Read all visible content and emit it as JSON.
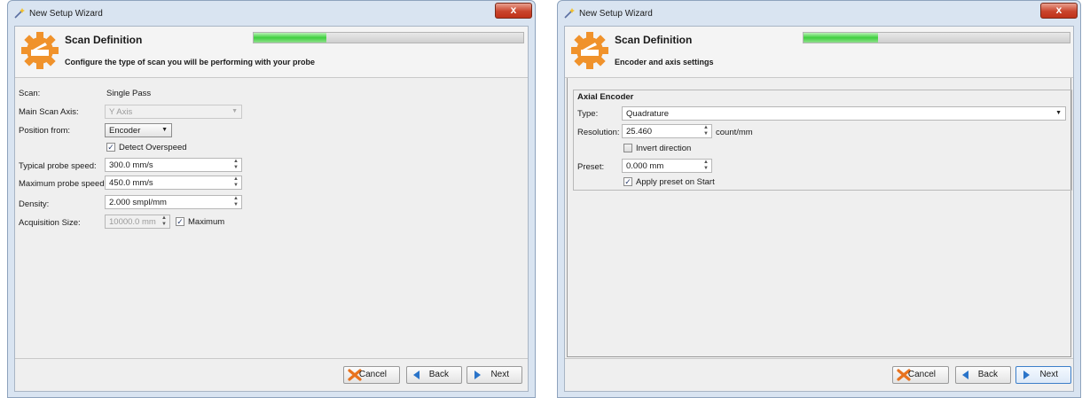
{
  "left_window": {
    "title": "New Setup Wizard",
    "close_label": "x",
    "header": {
      "title": "Scan Definition",
      "subtitle": "Configure the type of scan you will be performing with your probe",
      "progress_fraction": 0.27
    },
    "form": {
      "scan_label": "Scan:",
      "scan_value": "Single Pass",
      "main_axis_label": "Main Scan Axis:",
      "main_axis_value": "Y Axis",
      "position_from_label": "Position from:",
      "position_from_value": "Encoder",
      "detect_overspeed_label": "Detect Overspeed",
      "typical_speed_label": "Typical probe speed:",
      "typical_speed_value": "300.0 mm/s",
      "max_speed_label": "Maximum probe speed:",
      "max_speed_value": "450.0 mm/s",
      "density_label": "Density:",
      "density_value": "2.000 smpl/mm",
      "acq_size_label": "Acquisition Size:",
      "acq_size_value": "10000.0 mm",
      "maximum_label": "Maximum"
    },
    "footer": {
      "cancel": "Cancel",
      "back": "Back",
      "next": "Next"
    }
  },
  "right_window": {
    "title": "New Setup Wizard",
    "close_label": "x",
    "header": {
      "title": "Scan Definition",
      "subtitle": "Encoder and axis settings",
      "progress_fraction": 0.28
    },
    "group": {
      "title": "Axial Encoder",
      "type_label": "Type:",
      "type_value": "Quadrature",
      "resolution_label": "Resolution:",
      "resolution_value": "25.460",
      "resolution_unit": "count/mm",
      "invert_label": "Invert direction",
      "preset_label": "Preset:",
      "preset_value": "0.000 mm",
      "apply_preset_label": "Apply preset on Start"
    },
    "footer": {
      "cancel": "Cancel",
      "back": "Back",
      "next": "Next"
    }
  },
  "colors": {
    "accent_orange": "#f0922b",
    "progress_green": "#3fcf3f",
    "cancel_orange": "#e8731f",
    "nav_blue": "#2a74c9"
  }
}
